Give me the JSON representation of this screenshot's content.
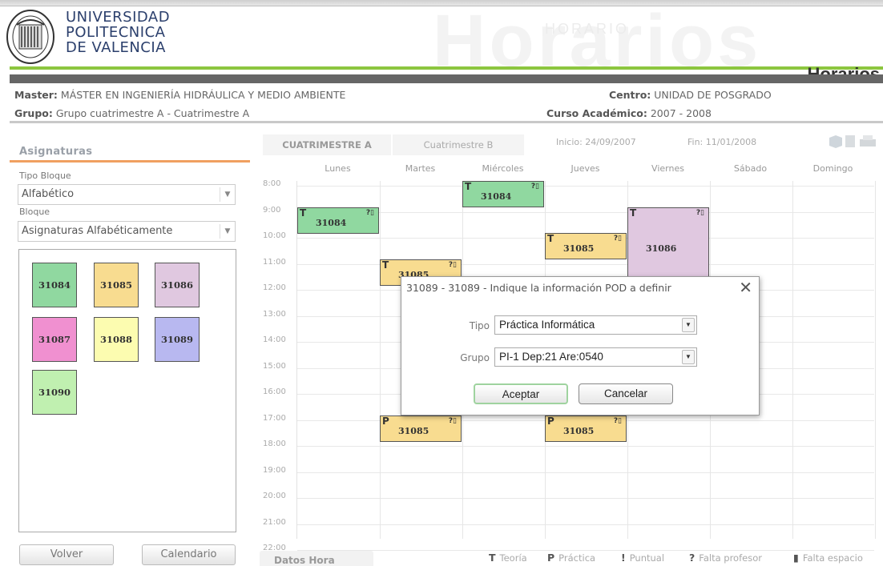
{
  "header": {
    "university_lines": [
      "UNIVERSIDAD",
      "POLITECNICA",
      "DE VALENCIA"
    ],
    "app_title": "Horarios",
    "watermark": "Horarios"
  },
  "info": {
    "master_label": "Master:",
    "master_value": "MÁSTER EN INGENIERÍA HIDRÁULICA Y MEDIO AMBIENTE",
    "centro_label": "Centro:",
    "centro_value": "UNIDAD DE POSGRADO",
    "grupo_label": "Grupo:",
    "grupo_value": "Grupo cuatrimestre A - Cuatrimestre A",
    "curso_label": "Curso Académico:",
    "curso_value": "2007 - 2008"
  },
  "sidebar": {
    "title": "Asignaturas",
    "tipo_bloque_label": "Tipo Bloque",
    "tipo_bloque_value": "Alfabético",
    "bloque_label": "Bloque",
    "bloque_value": "Asignaturas Alfabéticamente",
    "subjects": [
      {
        "code": "31084",
        "color": "#90d8a0"
      },
      {
        "code": "31085",
        "color": "#f8dc90"
      },
      {
        "code": "31086",
        "color": "#e0c8e0"
      },
      {
        "code": "31087",
        "color": "#f090d0"
      },
      {
        "code": "31088",
        "color": "#fcfcb0"
      },
      {
        "code": "31089",
        "color": "#b8b8f0"
      },
      {
        "code": "31090",
        "color": "#c0f0b0"
      }
    ],
    "volver_label": "Volver",
    "calendario_label": "Calendario"
  },
  "calendar": {
    "tab_a": "CUATRIMESTRE A",
    "tab_b": "Cuatrimestre B",
    "inicio": "Inicio: 24/09/2007",
    "fin": "Fin: 11/01/2008",
    "days": [
      "Lunes",
      "Martes",
      "Miércoles",
      "Jueves",
      "Viernes",
      "Sábado",
      "Domingo"
    ],
    "hours": [
      "8:00",
      "9:00",
      "10:00",
      "11:00",
      "12:00",
      "13:00",
      "14:00",
      "15:00",
      "16:00",
      "17:00",
      "18:00",
      "19:00",
      "20:00",
      "21:00",
      "22:00"
    ],
    "events": [
      {
        "type": "T",
        "code": "31084",
        "day": 0,
        "start": 9.0,
        "end": 10.0,
        "color": "#90d8a0",
        "icons": "?▯"
      },
      {
        "type": "T",
        "code": "31084",
        "day": 2,
        "start": 8.0,
        "end": 9.0,
        "color": "#90d8a0",
        "icons": "?▯"
      },
      {
        "type": "T",
        "code": "31085",
        "day": 1,
        "start": 11.0,
        "end": 12.0,
        "color": "#f8dc90",
        "icons": "?▯"
      },
      {
        "type": "T",
        "code": "31085",
        "day": 3,
        "start": 10.0,
        "end": 11.0,
        "color": "#f8dc90",
        "icons": "?▯"
      },
      {
        "type": "T",
        "code": "31086",
        "day": 4,
        "start": 9.0,
        "end": 12.3,
        "color": "#e0c8e0",
        "icons": "?▯"
      },
      {
        "type": "P",
        "code": "31085",
        "day": 1,
        "start": 17.0,
        "end": 18.0,
        "color": "#f8dc90",
        "icons": "?▯"
      },
      {
        "type": "P",
        "code": "31085",
        "day": 3,
        "start": 17.0,
        "end": 18.0,
        "color": "#f8dc90",
        "icons": "?▯"
      }
    ],
    "datos_hora_tab": "Datos Hora"
  },
  "legend": [
    {
      "symbol": "T",
      "label": "Teoría"
    },
    {
      "symbol": "P",
      "label": "Práctica"
    },
    {
      "symbol": "!",
      "label": "Puntual"
    },
    {
      "symbol": "?",
      "label": "Falta profesor"
    },
    {
      "symbol": "▮",
      "label": "Falta espacio"
    }
  ],
  "dialog": {
    "title": "31089 - 31089 - Indique la información POD a definir",
    "tipo_label": "Tipo",
    "tipo_value": "Práctica Informática",
    "grupo_label": "Grupo",
    "grupo_value": "PI-1 Dep:21 Are:0540",
    "accept_label": "Aceptar",
    "cancel_label": "Cancelar"
  }
}
